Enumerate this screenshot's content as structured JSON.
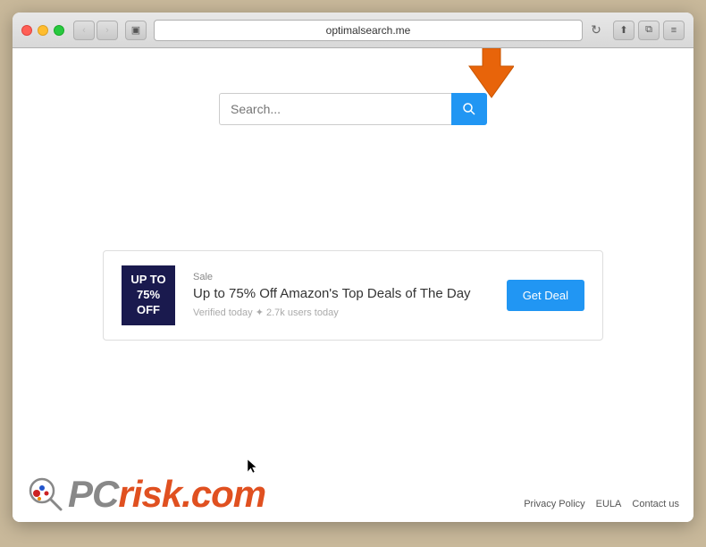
{
  "browser": {
    "url": "optimalsearch.me",
    "back_disabled": true,
    "forward_disabled": true
  },
  "search": {
    "placeholder": "Search...",
    "button_label": "🔍"
  },
  "ad": {
    "badge_line1": "UP TO",
    "badge_line2": "75%",
    "badge_line3": "OFF",
    "sale_label": "Sale",
    "title": "Up to 75% Off Amazon's Top Deals of The Day",
    "meta": "Verified today ✦ 2.7k users today",
    "cta_label": "Get Deal"
  },
  "footer": {
    "links": [
      "Privacy Policy",
      "EULA",
      "Contact us"
    ]
  }
}
